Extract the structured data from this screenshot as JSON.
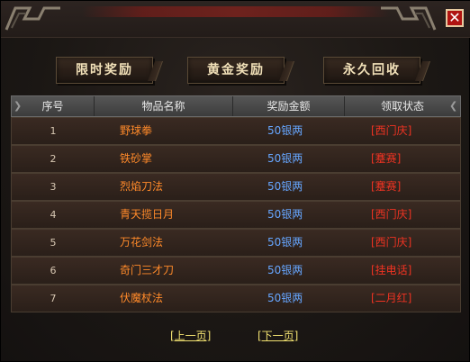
{
  "tabs": [
    "限时奖励",
    "黄金奖励",
    "永久回收"
  ],
  "close_label": "✕",
  "columns": [
    "序号",
    "物品名称",
    "奖励金额",
    "领取状态"
  ],
  "rows": [
    {
      "no": "1",
      "item": "野球拳",
      "reward": "50银两",
      "status": "[西门庆]"
    },
    {
      "no": "2",
      "item": "铁砂掌",
      "reward": "50银两",
      "status": "[蹇赛]"
    },
    {
      "no": "3",
      "item": "烈焰刀法",
      "reward": "50银两",
      "status": "[蹇赛]"
    },
    {
      "no": "4",
      "item": "青天揽日月",
      "reward": "50银两",
      "status": "[西门庆]"
    },
    {
      "no": "5",
      "item": "万花剑法",
      "reward": "50银两",
      "status": "[西门庆]"
    },
    {
      "no": "6",
      "item": "奇门三才刀",
      "reward": "50银两",
      "status": "[挂电话]"
    },
    {
      "no": "7",
      "item": "伏魔杖法",
      "reward": "50银两",
      "status": "[二月红]"
    }
  ],
  "pager": {
    "prev": "[上一页]",
    "next": "[下一页]"
  },
  "colors": {
    "item": "#ff8a2a",
    "reward": "#66a6ff",
    "status": "#ee3322",
    "pager": "#f0e070"
  }
}
